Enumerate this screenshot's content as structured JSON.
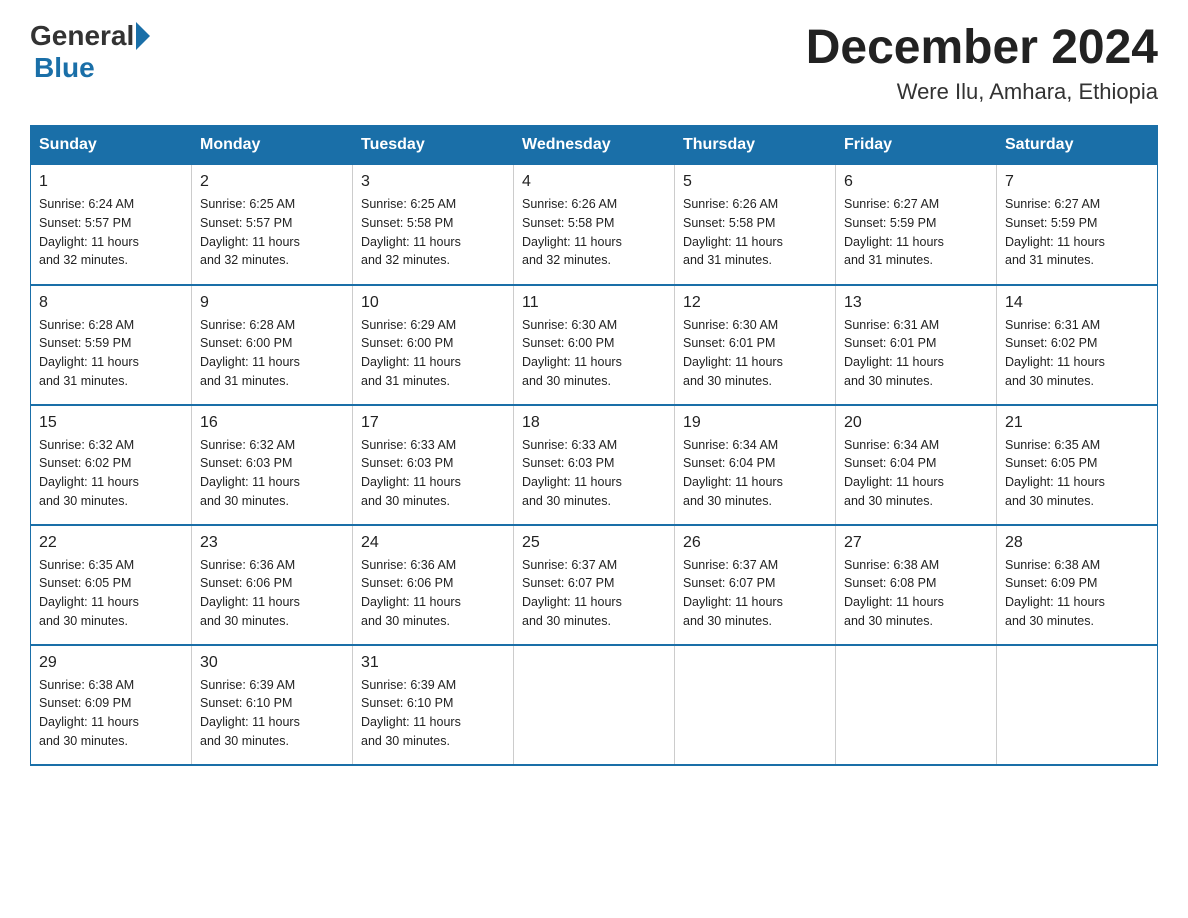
{
  "header": {
    "logo": {
      "text_general": "General",
      "text_blue": "Blue"
    },
    "month_year": "December 2024",
    "location": "Were Ilu, Amhara, Ethiopia"
  },
  "days_of_week": [
    "Sunday",
    "Monday",
    "Tuesday",
    "Wednesday",
    "Thursday",
    "Friday",
    "Saturday"
  ],
  "weeks": [
    [
      {
        "date": "1",
        "sunrise": "6:24 AM",
        "sunset": "5:57 PM",
        "daylight": "11 hours and 32 minutes."
      },
      {
        "date": "2",
        "sunrise": "6:25 AM",
        "sunset": "5:57 PM",
        "daylight": "11 hours and 32 minutes."
      },
      {
        "date": "3",
        "sunrise": "6:25 AM",
        "sunset": "5:58 PM",
        "daylight": "11 hours and 32 minutes."
      },
      {
        "date": "4",
        "sunrise": "6:26 AM",
        "sunset": "5:58 PM",
        "daylight": "11 hours and 32 minutes."
      },
      {
        "date": "5",
        "sunrise": "6:26 AM",
        "sunset": "5:58 PM",
        "daylight": "11 hours and 31 minutes."
      },
      {
        "date": "6",
        "sunrise": "6:27 AM",
        "sunset": "5:59 PM",
        "daylight": "11 hours and 31 minutes."
      },
      {
        "date": "7",
        "sunrise": "6:27 AM",
        "sunset": "5:59 PM",
        "daylight": "11 hours and 31 minutes."
      }
    ],
    [
      {
        "date": "8",
        "sunrise": "6:28 AM",
        "sunset": "5:59 PM",
        "daylight": "11 hours and 31 minutes."
      },
      {
        "date": "9",
        "sunrise": "6:28 AM",
        "sunset": "6:00 PM",
        "daylight": "11 hours and 31 minutes."
      },
      {
        "date": "10",
        "sunrise": "6:29 AM",
        "sunset": "6:00 PM",
        "daylight": "11 hours and 31 minutes."
      },
      {
        "date": "11",
        "sunrise": "6:30 AM",
        "sunset": "6:00 PM",
        "daylight": "11 hours and 30 minutes."
      },
      {
        "date": "12",
        "sunrise": "6:30 AM",
        "sunset": "6:01 PM",
        "daylight": "11 hours and 30 minutes."
      },
      {
        "date": "13",
        "sunrise": "6:31 AM",
        "sunset": "6:01 PM",
        "daylight": "11 hours and 30 minutes."
      },
      {
        "date": "14",
        "sunrise": "6:31 AM",
        "sunset": "6:02 PM",
        "daylight": "11 hours and 30 minutes."
      }
    ],
    [
      {
        "date": "15",
        "sunrise": "6:32 AM",
        "sunset": "6:02 PM",
        "daylight": "11 hours and 30 minutes."
      },
      {
        "date": "16",
        "sunrise": "6:32 AM",
        "sunset": "6:03 PM",
        "daylight": "11 hours and 30 minutes."
      },
      {
        "date": "17",
        "sunrise": "6:33 AM",
        "sunset": "6:03 PM",
        "daylight": "11 hours and 30 minutes."
      },
      {
        "date": "18",
        "sunrise": "6:33 AM",
        "sunset": "6:03 PM",
        "daylight": "11 hours and 30 minutes."
      },
      {
        "date": "19",
        "sunrise": "6:34 AM",
        "sunset": "6:04 PM",
        "daylight": "11 hours and 30 minutes."
      },
      {
        "date": "20",
        "sunrise": "6:34 AM",
        "sunset": "6:04 PM",
        "daylight": "11 hours and 30 minutes."
      },
      {
        "date": "21",
        "sunrise": "6:35 AM",
        "sunset": "6:05 PM",
        "daylight": "11 hours and 30 minutes."
      }
    ],
    [
      {
        "date": "22",
        "sunrise": "6:35 AM",
        "sunset": "6:05 PM",
        "daylight": "11 hours and 30 minutes."
      },
      {
        "date": "23",
        "sunrise": "6:36 AM",
        "sunset": "6:06 PM",
        "daylight": "11 hours and 30 minutes."
      },
      {
        "date": "24",
        "sunrise": "6:36 AM",
        "sunset": "6:06 PM",
        "daylight": "11 hours and 30 minutes."
      },
      {
        "date": "25",
        "sunrise": "6:37 AM",
        "sunset": "6:07 PM",
        "daylight": "11 hours and 30 minutes."
      },
      {
        "date": "26",
        "sunrise": "6:37 AM",
        "sunset": "6:07 PM",
        "daylight": "11 hours and 30 minutes."
      },
      {
        "date": "27",
        "sunrise": "6:38 AM",
        "sunset": "6:08 PM",
        "daylight": "11 hours and 30 minutes."
      },
      {
        "date": "28",
        "sunrise": "6:38 AM",
        "sunset": "6:09 PM",
        "daylight": "11 hours and 30 minutes."
      }
    ],
    [
      {
        "date": "29",
        "sunrise": "6:38 AM",
        "sunset": "6:09 PM",
        "daylight": "11 hours and 30 minutes."
      },
      {
        "date": "30",
        "sunrise": "6:39 AM",
        "sunset": "6:10 PM",
        "daylight": "11 hours and 30 minutes."
      },
      {
        "date": "31",
        "sunrise": "6:39 AM",
        "sunset": "6:10 PM",
        "daylight": "11 hours and 30 minutes."
      },
      null,
      null,
      null,
      null
    ]
  ],
  "labels": {
    "sunrise": "Sunrise:",
    "sunset": "Sunset:",
    "daylight": "Daylight:"
  }
}
